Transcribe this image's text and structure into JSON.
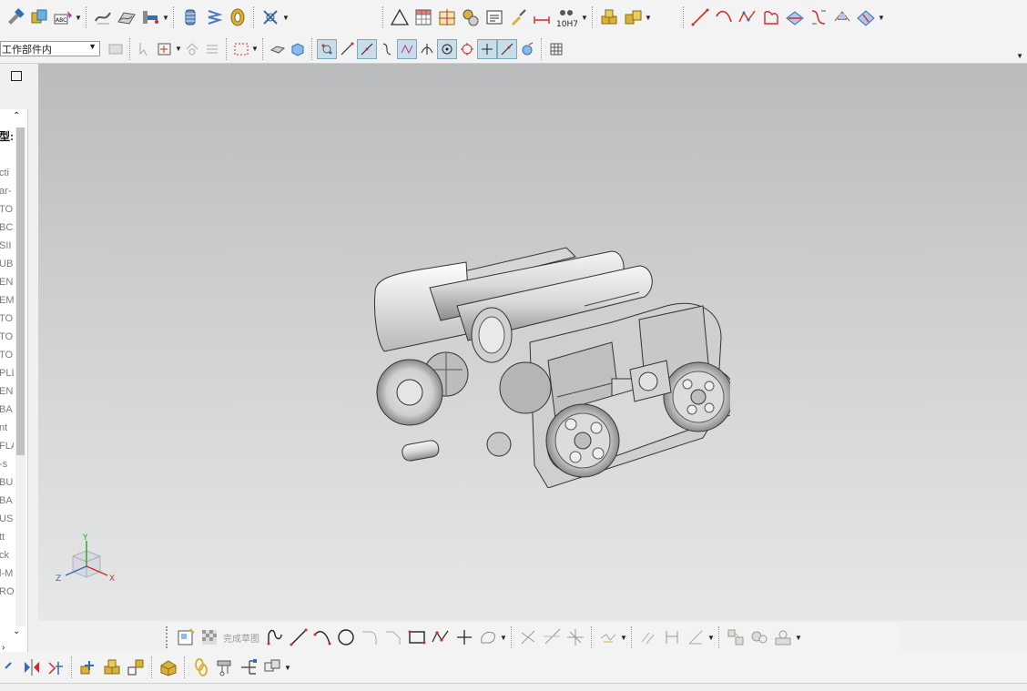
{
  "toolbar_top": {
    "groups": [
      [
        "hammer-icon",
        "box-swap-icon",
        "text-format-icon"
      ],
      [
        "sweep-icon",
        "wave-surface-icon",
        "hand-point-icon"
      ],
      [
        "spring-coil-icon",
        "spring-icon",
        "bearing-icon"
      ],
      [
        "wire-tool-icon"
      ],
      [
        "triangle-icon",
        "table-grid-icon",
        "crosshair-table-icon",
        "gears-icon",
        "note-icon",
        "brush-icon",
        "dimension-icon",
        "fit-tolerance-icon"
      ],
      [
        "cube-stack-icon",
        "cube-pair-icon"
      ],
      [
        "line-icon",
        "arc-icon",
        "spline-icon",
        "shape-icon",
        "surface-red-icon",
        "bridge-curve-icon",
        "trim-icon",
        "blend-icon"
      ]
    ],
    "fit_label": "10H7"
  },
  "toolbar_second": {
    "selection_filter": "工作部件内",
    "snap_icons": [
      "snap-point-icon",
      "snap-end-icon",
      "snap-mid-icon",
      "snap-curve-icon",
      "snap-intersect-icon",
      "snap-center-icon",
      "snap-quadrant-icon",
      "snap-existing-icon",
      "snap-onpoint-icon",
      "snap-pole-icon"
    ]
  },
  "left_panel": {
    "header": "型:",
    "rows": [
      "cti",
      "ar-",
      "TO",
      "BC",
      "SII",
      "UB",
      "EN",
      "EM",
      "TO",
      "TO",
      "TO",
      "PLL",
      "EN",
      "BA",
      "nt",
      "FLA",
      "-s",
      "BU",
      "BA",
      "US",
      "tt",
      "ck",
      "l-M",
      "RO"
    ]
  },
  "triad": {
    "x": "X",
    "y": "Y",
    "z": "Z"
  },
  "sketch_bar": {
    "finish_label": "完成草图"
  },
  "colors": {
    "accent_blue": "#2f6db6",
    "accent_red": "#d12b2b",
    "icon_gold": "#d8b23b",
    "viewport_top": "#b9bbbc",
    "viewport_bottom": "#e6e7e7"
  }
}
